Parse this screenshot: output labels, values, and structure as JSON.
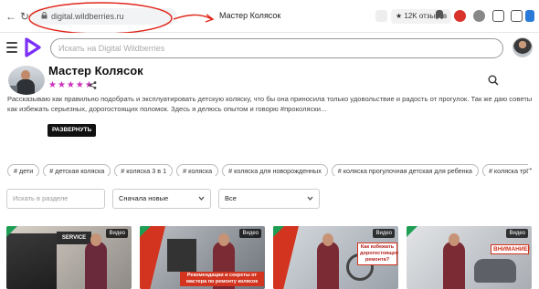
{
  "browser": {
    "url": "digital.wildberries.ru",
    "tab_title": "Мастер Колясок",
    "reviews_badge": "★ 12K отзывов"
  },
  "header": {
    "search_placeholder": "Искать на Digital Wildberries"
  },
  "channel": {
    "name": "Мастер Колясок",
    "rating_stars": 5,
    "stars_text": "★★★★★",
    "description": "Рассказываю как правильно подобрать и эксплуатировать детскую коляску, что бы она приносила только удовольствие и радость от прогулок. Так же даю советы как избежать серьезных, дорогостоящих поломок. Здесь я делюсь опытом и говорю #проколяски...",
    "expand_label": "РАЗВЕРНУТЬ"
  },
  "tags": [
    "# дети",
    "# детская коляска",
    "# коляска 3 в 1",
    "# коляска",
    "# коляска для новорожденных",
    "# коляска прогулочная детская для ребенка",
    "# коляска тро"
  ],
  "filters": {
    "search_placeholder": "Искать в разделе",
    "sort_value": "Сначала новые",
    "type_value": "Все"
  },
  "videos": [
    {
      "badge": "Видео",
      "overlay": "SERVICE"
    },
    {
      "badge": "Видео",
      "overlay": "Рекомендации и секреты от мастера по ремонту колясок"
    },
    {
      "badge": "Видео",
      "overlay": "Как избежать дорогостоящего ремонта?"
    },
    {
      "badge": "Видео",
      "overlay": "ВНИМАНИЕ!"
    }
  ],
  "colors": {
    "accent_star": "#cc2fbd",
    "annotation": "#e0261b",
    "logo": "#7b2ff7"
  }
}
